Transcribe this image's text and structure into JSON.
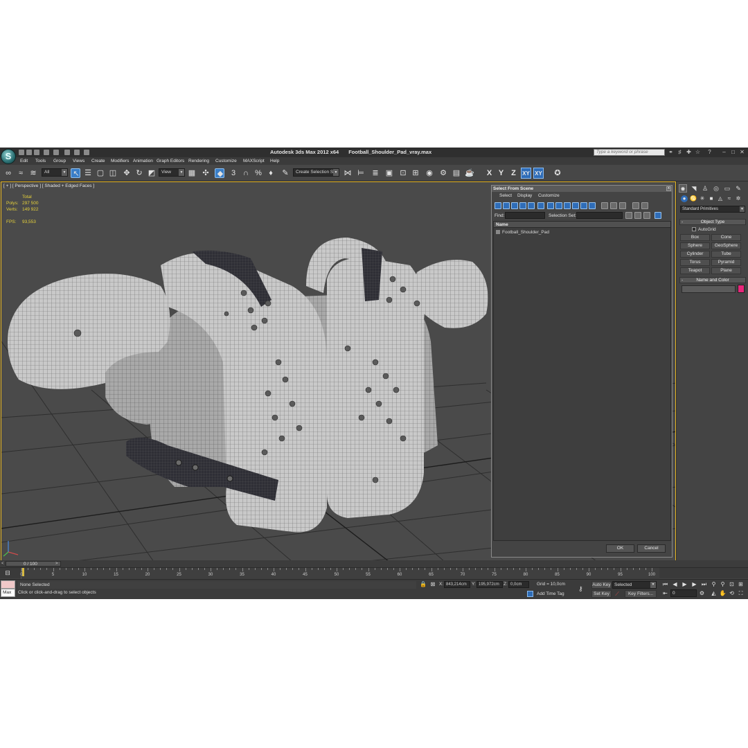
{
  "window": {
    "app_name": "Autodesk 3ds Max  2012 x64",
    "file_name": "Football_Shoulder_Pad_vray.max",
    "search_placeholder": "Type a keyword or phrase"
  },
  "menu": [
    "Edit",
    "Tools",
    "Group",
    "Views",
    "Create",
    "Modifiers",
    "Animation",
    "Graph Editors",
    "Rendering",
    "Customize",
    "MAXScript",
    "Help"
  ],
  "toolbar": {
    "filter_value": "All",
    "refcoord_value": "View",
    "snap_label": "3",
    "selection_set_value": "Create Selection Se",
    "axis": {
      "x": "X",
      "y": "Y",
      "z": "Z",
      "xy": "XY",
      "xy2": "XY"
    }
  },
  "viewport": {
    "label": "[ + ] [ Perspective ] [ Shaded + Edged Faces ]",
    "stats": {
      "total_label": "Total",
      "polys_label": "Polys:",
      "polys_value": "297 500",
      "verts_label": "Verts:",
      "verts_value": "149 922",
      "fps_label": "FPS:",
      "fps_value": "93,553"
    }
  },
  "dialog": {
    "title": "Select From Scene",
    "close": "x",
    "menu": [
      "Select",
      "Display",
      "Customize"
    ],
    "find_label": "Find:",
    "selset_label": "Selection Set:",
    "column_header": "Name",
    "items": [
      "Football_Shoulder_Pad"
    ],
    "ok_label": "OK",
    "cancel_label": "Cancel"
  },
  "command_panel": {
    "dropdown_value": "Standard Primitives",
    "object_type_header": "Object Type",
    "rollout_minus": "-",
    "autogrid_label": "AutoGrid",
    "primitives": [
      "Box",
      "Cone",
      "Sphere",
      "GeoSphere",
      "Cylinder",
      "Tube",
      "Torus",
      "Pyramid",
      "Teapot",
      "Plane"
    ],
    "name_color_header": "Name and Color",
    "swatch_color": "#e8267a"
  },
  "time_slider": {
    "label": "0 / 100",
    "left_arrow": "<",
    "right_arrow": ">"
  },
  "track_ticks": [
    "0",
    "5",
    "10",
    "15",
    "20",
    "25",
    "30",
    "35",
    "40",
    "45",
    "50",
    "55",
    "60",
    "65",
    "70",
    "75",
    "80",
    "85",
    "90",
    "95",
    "100"
  ],
  "status": {
    "maxscript_label": "Max",
    "selection_text": "None Selected",
    "prompt_text": "Click or click-and-drag to select objects",
    "x_label": "X:",
    "x_value": "843,214cm",
    "y_label": "Y:",
    "y_value": "195,972cm",
    "z_label": "Z:",
    "z_value": "0,0cm",
    "grid_text": "Grid = 10,0cm",
    "add_time_tag": "Add Time Tag",
    "auto_key": "Auto Key",
    "set_key": "Set Key",
    "selected_value": "Selected",
    "key_filters": "Key Filters...",
    "frame_value": "0"
  },
  "icons": {
    "undo": "undo-icon",
    "redo": "redo-icon",
    "select": "select-object-icon",
    "move": "move-icon",
    "rotate": "rotate-icon",
    "scale": "scale-icon",
    "render": "render-icon",
    "play": "play-icon",
    "key": "key-icon"
  },
  "colors": {
    "accent_blue": "#2f6db8",
    "viewport_border": "#e9b824",
    "stats_text": "#e7d23a"
  }
}
